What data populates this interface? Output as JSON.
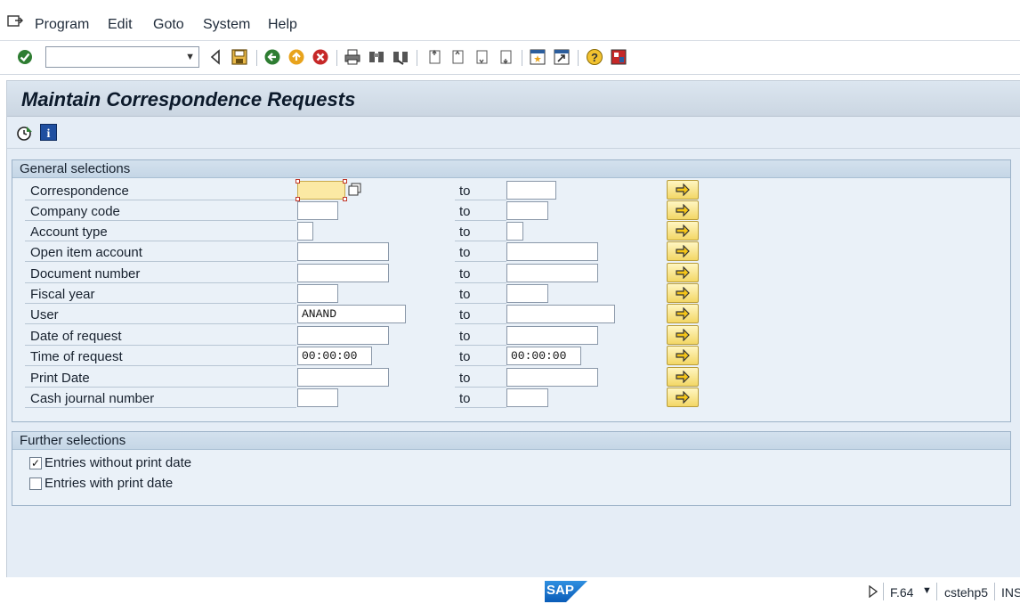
{
  "menu": [
    "Program",
    "Edit",
    "Goto",
    "System",
    "Help"
  ],
  "toolbar": {
    "command_value": "",
    "icons": [
      "enter-icon",
      "back-arrow-icon",
      "save-icon",
      "back-icon",
      "exit-icon",
      "cancel-icon",
      "print-icon",
      "find-icon",
      "find-next-icon",
      "first-page-icon",
      "previous-page-icon",
      "next-page-icon",
      "last-page-icon",
      "create-session-icon",
      "shortcut-icon",
      "help-icon",
      "layout-icon"
    ]
  },
  "page": {
    "title": "Maintain Correspondence Requests"
  },
  "app_toolbar": {
    "icons": [
      "execute-icon",
      "info-icon"
    ]
  },
  "general": {
    "title": "General selections",
    "to_label": "to",
    "rows": [
      {
        "label": "Correspondence",
        "from": "",
        "to": ""
      },
      {
        "label": "Company code",
        "from": "",
        "to": ""
      },
      {
        "label": "Account type",
        "from": "",
        "to": ""
      },
      {
        "label": "Open item account",
        "from": "",
        "to": ""
      },
      {
        "label": "Document number",
        "from": "",
        "to": ""
      },
      {
        "label": "Fiscal year",
        "from": "",
        "to": ""
      },
      {
        "label": "User",
        "from": "ANAND",
        "to": ""
      },
      {
        "label": "Date of request",
        "from": "",
        "to": ""
      },
      {
        "label": "Time of request",
        "from": "00:00:00",
        "to": "00:00:00"
      },
      {
        "label": "Print Date",
        "from": "",
        "to": ""
      },
      {
        "label": "Cash journal number",
        "from": "",
        "to": ""
      }
    ]
  },
  "further": {
    "title": "Further selections",
    "options": [
      {
        "label": "Entries without print date",
        "checked": true,
        "mark": "✓"
      },
      {
        "label": "Entries with print date",
        "checked": false,
        "mark": ""
      }
    ]
  },
  "status": {
    "logo": "SAP",
    "transaction": "F.64",
    "server": "cstehp5",
    "mode": "INS"
  },
  "colors": {
    "focus_field": "#fbe9a4",
    "selection_button": "#f3d766",
    "panel_background": "#e5edf6"
  }
}
